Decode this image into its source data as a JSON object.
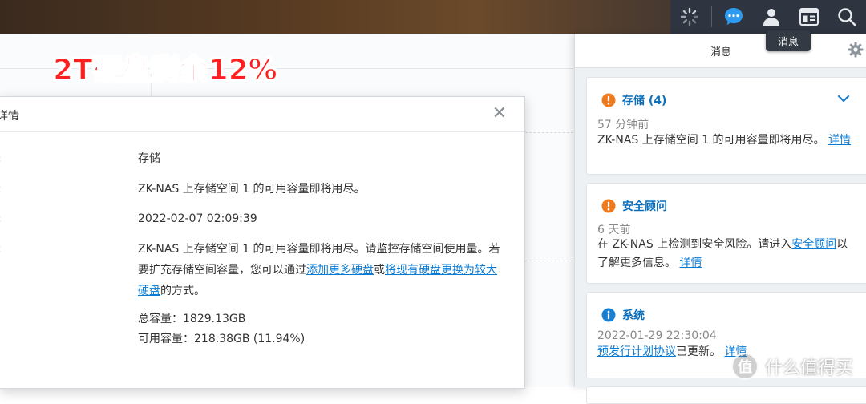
{
  "headline": "2T硬盘剩余12%",
  "taskbar": {
    "icons": [
      "spinner-icon",
      "chat-bubble-icon",
      "user-icon",
      "widget-icon",
      "search-icon"
    ],
    "tooltip": "消息"
  },
  "dialog": {
    "title": "详情",
    "rows": [
      {
        "label": ":",
        "value": "存储"
      },
      {
        "label": ":",
        "value": "ZK-NAS 上存储空间 1 的可用容量即将用尽。"
      },
      {
        "label": ":",
        "value": "2022-02-07 02:09:39"
      },
      {
        "label": ":",
        "text_a": "ZK-NAS 上存储空间 1 的可用容量即将用尽。请监控存储空间使用量。若要扩充存储空间容量，您可以通过",
        "link_a": "添加更多硬盘",
        "text_b": "或",
        "link_b": "将现有硬盘更换为较大硬盘",
        "text_c": "的方式。"
      }
    ],
    "total_capacity": "总容量：1829.13GB",
    "free_capacity": "可用容量：218.38GB (11.94%)"
  },
  "panel": {
    "title": "消息",
    "cards": [
      {
        "category": "存储 (4)",
        "time": "57 分钟前",
        "text": "ZK-NAS 上存储空间 1 的可用容量即将用尽。",
        "link": "详情",
        "icon": "warning-icon",
        "icon_color": "#ee7a1d"
      },
      {
        "category": "安全顾问",
        "time": "6 天前",
        "text_a": "在 ZK-NAS 上检测到安全风险。请进入",
        "link_a": "安全顾问",
        "text_b": "以了解更多信息。",
        "link": "详情",
        "icon": "warning-icon",
        "icon_color": "#ee7a1d"
      },
      {
        "category": "系统",
        "time": "2022-01-29 22:30:04",
        "link_a": "预发行计划协议",
        "text_b": "已更新。",
        "link": "详情",
        "icon": "info-icon",
        "icon_color": "#1b7fd1"
      }
    ]
  },
  "watermark": {
    "mark": "值",
    "text": "什么值得买"
  },
  "colors": {
    "accent": "#0a6fbd",
    "link": "#0a7bd4",
    "warning": "#ee7a1d",
    "headline": "#ff1f1f"
  }
}
